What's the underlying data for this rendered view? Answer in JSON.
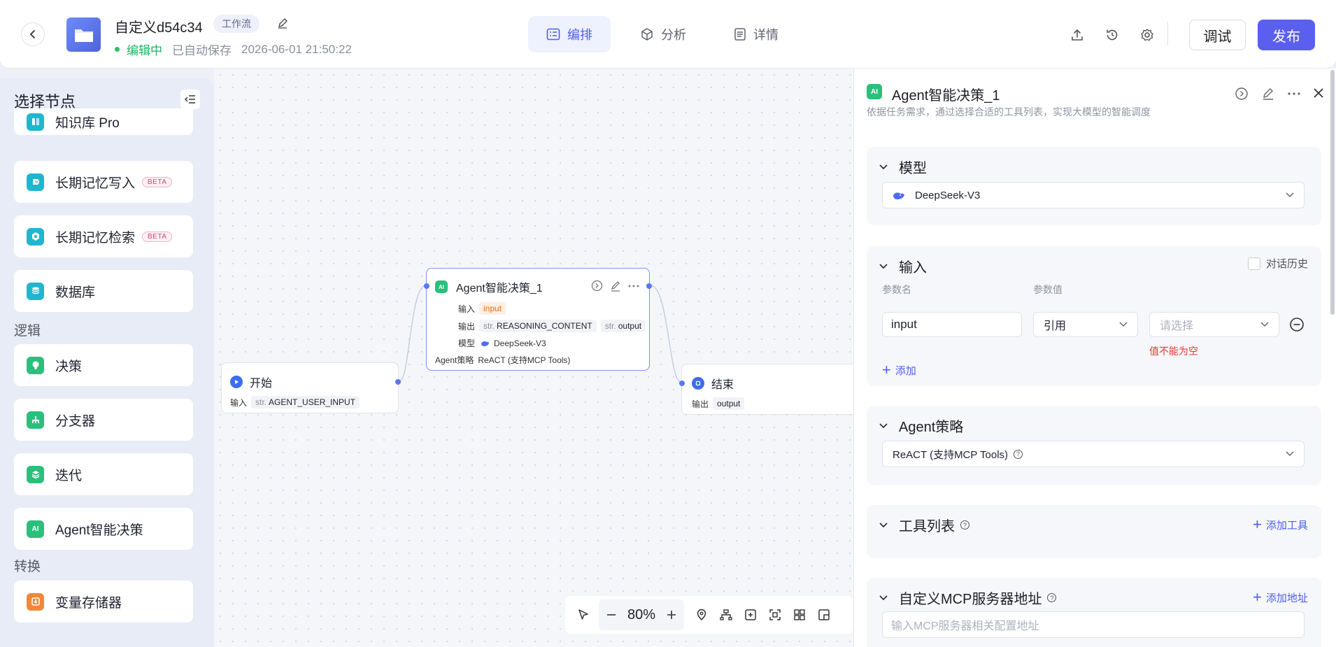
{
  "header": {
    "title": "自定义d54c34",
    "tag": "工作流",
    "status_editing": "编辑中",
    "autosave": "已自动保存",
    "timestamp": "2026-06-01 21:50:22",
    "tabs": [
      {
        "label": "编排",
        "active": true
      },
      {
        "label": "分析",
        "active": false
      },
      {
        "label": "详情",
        "active": false
      }
    ],
    "debug_label": "调试",
    "publish_label": "发布",
    "accent_color": "#5b5ff0"
  },
  "sidebar": {
    "title": "选择节点",
    "items_top": [
      {
        "label": "知识库 Pro",
        "icon": "knowledge-icon",
        "color": "#1fb6d0"
      },
      {
        "label": "长期记忆写入",
        "icon": "memory-write-icon",
        "color": "#1fb6d0",
        "badge": "BETA"
      },
      {
        "label": "长期记忆检索",
        "icon": "memory-search-icon",
        "color": "#1fb6d0",
        "badge": "BETA"
      },
      {
        "label": "数据库",
        "icon": "database-icon",
        "color": "#1fb6d0"
      }
    ],
    "section_logic": "逻辑",
    "items_logic": [
      {
        "label": "决策",
        "icon": "decision-icon",
        "color": "#2bbf7c"
      },
      {
        "label": "分支器",
        "icon": "branch-icon",
        "color": "#2bbf7c"
      },
      {
        "label": "迭代",
        "icon": "iterate-icon",
        "color": "#2bbf7c"
      },
      {
        "label": "Agent智能决策",
        "icon": "agent-icon",
        "color": "#2bbf7c"
      }
    ],
    "section_transform": "转换",
    "items_transform": [
      {
        "label": "变量存储器",
        "icon": "variable-store-icon",
        "color": "#f0883a"
      }
    ]
  },
  "canvas": {
    "start_node": {
      "title": "开始",
      "input_label": "输入",
      "type": "str.",
      "var": "AGENT_USER_INPUT"
    },
    "agent_node": {
      "title": "Agent智能决策_1",
      "input_label": "输入",
      "input_var": "input",
      "output_label": "输出",
      "out1_type": "str.",
      "out1_var": "REASONING_CONTENT",
      "out2_type": "str.",
      "out2_var": "output",
      "model_label": "模型",
      "model": "DeepSeek-V3",
      "strategy_label": "Agent策略",
      "strategy": "ReACT (支持MCP Tools)"
    },
    "end_node": {
      "title": "结束",
      "output_label": "输出",
      "var": "output"
    },
    "zoom": "80%"
  },
  "panel": {
    "title": "Agent智能决策_1",
    "description": "依据任务需求，通过选择合适的工具列表，实现大模型的智能调度",
    "model_section": "模型",
    "model_value": "DeepSeek-V3",
    "input_section": "输入",
    "chat_history": "对话历史",
    "param_name_header": "参数名",
    "param_value_header": "参数值",
    "param_name": "input",
    "param_source": "引用",
    "param_value_placeholder": "请选择",
    "error_text": "值不能为空",
    "add_label": "添加",
    "strategy_section": "Agent策略",
    "strategy_value": "ReACT (支持MCP Tools)",
    "tools_section": "工具列表",
    "add_tool": "添加工具",
    "mcp_section": "自定义MCP服务器地址",
    "add_address": "添加地址",
    "mcp_placeholder": "输入MCP服务器相关配置地址"
  }
}
